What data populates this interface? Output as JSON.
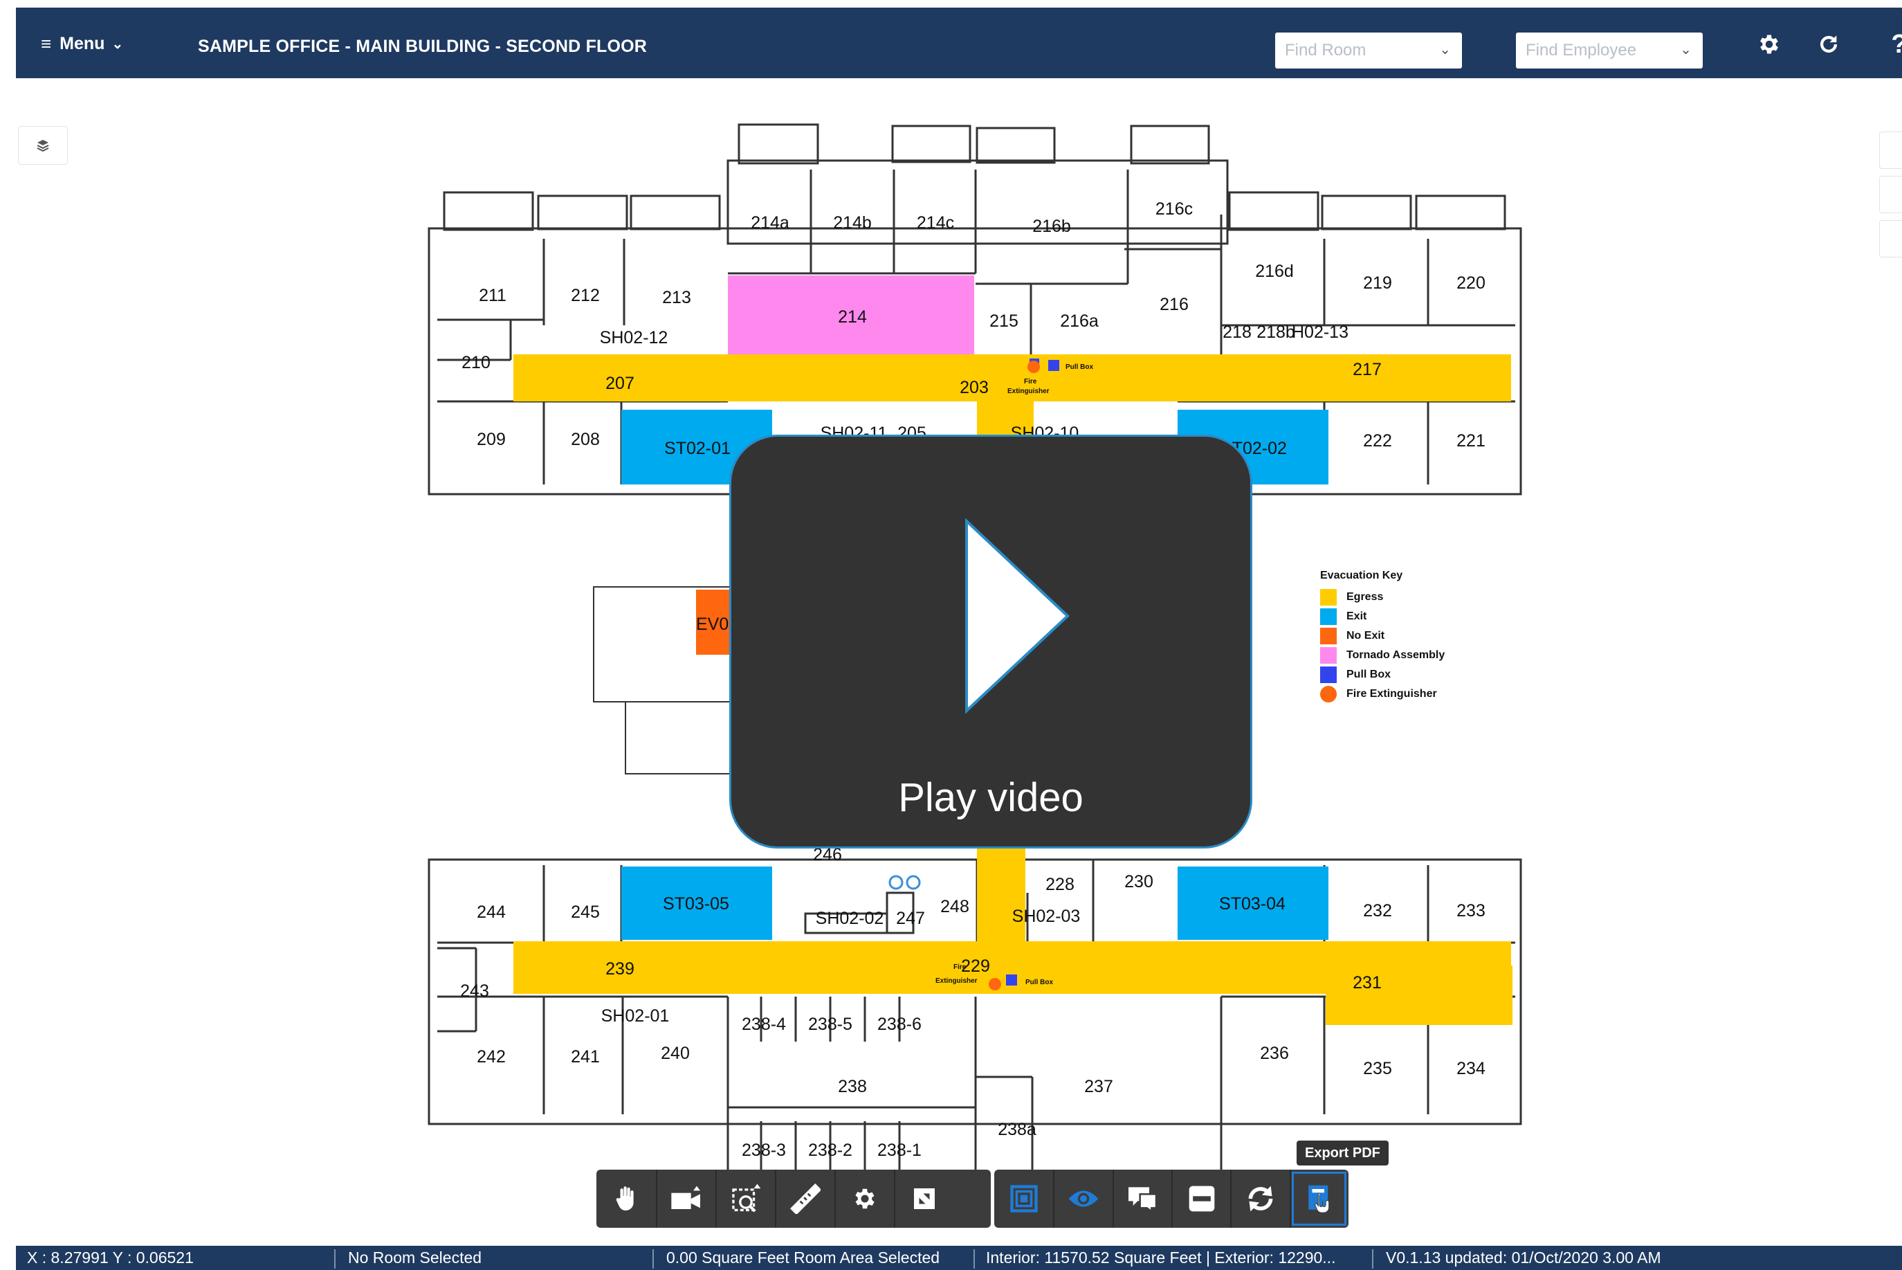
{
  "header": {
    "menu_label": "Menu",
    "title": "SAMPLE OFFICE - MAIN BUILDING - SECOND FLOOR",
    "find_room_placeholder": "Find Room",
    "find_employee_placeholder": "Find Employee",
    "help_label": "?"
  },
  "floorplan": {
    "rooms": {
      "r214a": "214a",
      "r214b": "214b",
      "r214c": "214c",
      "r216b": "216b",
      "r216c": "216c",
      "r211": "211",
      "r212": "212",
      "r213": "213",
      "r214": "214",
      "r215": "215",
      "r216a": "216a",
      "r216": "216",
      "r216d": "216d",
      "r219": "219",
      "r220": "220",
      "r210": "210",
      "sh0212": "SH02-12",
      "r218": "218",
      "r218b": "218b",
      "sh0213": "H02-13",
      "r207": "207",
      "r203": "203",
      "r217": "217",
      "r209": "209",
      "r208": "208",
      "st0201": "ST02-01",
      "sh0211": "SH02-11",
      "r205": "205",
      "sh0210": "SH02-10",
      "st0202": "ST02-02",
      "r222": "222",
      "r221": "221",
      "ev0": "EV0",
      "r246": "246",
      "r228": "228",
      "r230": "230",
      "r244": "244",
      "r245": "245",
      "st0305": "ST03-05",
      "sh0202": "SH02-02",
      "r247": "247",
      "r248": "248",
      "sh0203": "SH02-03",
      "st0304": "ST03-04",
      "r232": "232",
      "r233": "233",
      "r243": "243",
      "r239": "239",
      "r229": "229",
      "r231": "231",
      "sh0201": "SH02-01",
      "r2384": "238-4",
      "r2385": "238-5",
      "r2386": "238-6",
      "r242": "242",
      "r241": "241",
      "r240": "240",
      "r236": "236",
      "r235": "235",
      "r234": "234",
      "r238": "238",
      "r237": "237",
      "r238a": "238a",
      "r2383": "238-3",
      "r2382": "238-2",
      "r2381": "238-1"
    },
    "pull_box_label": "Pull Box",
    "fire_ext_label_top": "Fire",
    "fire_ext_label_bottom": "Extinguisher"
  },
  "legend": {
    "title": "Evacuation Key",
    "items": [
      {
        "label": "Egress",
        "color": "#ffcc00",
        "shape": "square"
      },
      {
        "label": "Exit",
        "color": "#00aaee",
        "shape": "square"
      },
      {
        "label": "No Exit",
        "color": "#ff6610",
        "shape": "square"
      },
      {
        "label": "Tornado Assembly",
        "color": "#ff88ee",
        "shape": "square"
      },
      {
        "label": "Pull Box",
        "color": "#3344ee",
        "shape": "square"
      },
      {
        "label": "Fire Extinguisher",
        "color": "#ff6610",
        "shape": "circle"
      }
    ]
  },
  "overlay": {
    "play_label": "Play video"
  },
  "toolbar": {
    "tooltip": "Export PDF",
    "group1": [
      "pan-hand",
      "camera-view",
      "zoom-region",
      "measure-ruler",
      "settings-gear",
      "fullscreen"
    ],
    "group2": [
      "select-area",
      "visibility-eye",
      "room-labels",
      "minus-layer",
      "rotate-sync",
      "export-pdf"
    ]
  },
  "statusbar": {
    "coords": "X : 8.27991 Y : 0.06521",
    "room_selected": "No Room Selected",
    "area_selected": "0.00 Square Feet Room Area Selected",
    "interior_exterior": "Interior: 11570.52 Square Feet | Exterior: 12290...",
    "version": "V0.1.13 updated: 01/Oct/2020 3.00 AM"
  },
  "colors": {
    "header": "#1f3a61",
    "egress": "#ffcc00",
    "exit": "#00aaee",
    "tornado": "#ff88ee",
    "no_exit": "#ff6610",
    "pull_box": "#3344ee"
  }
}
